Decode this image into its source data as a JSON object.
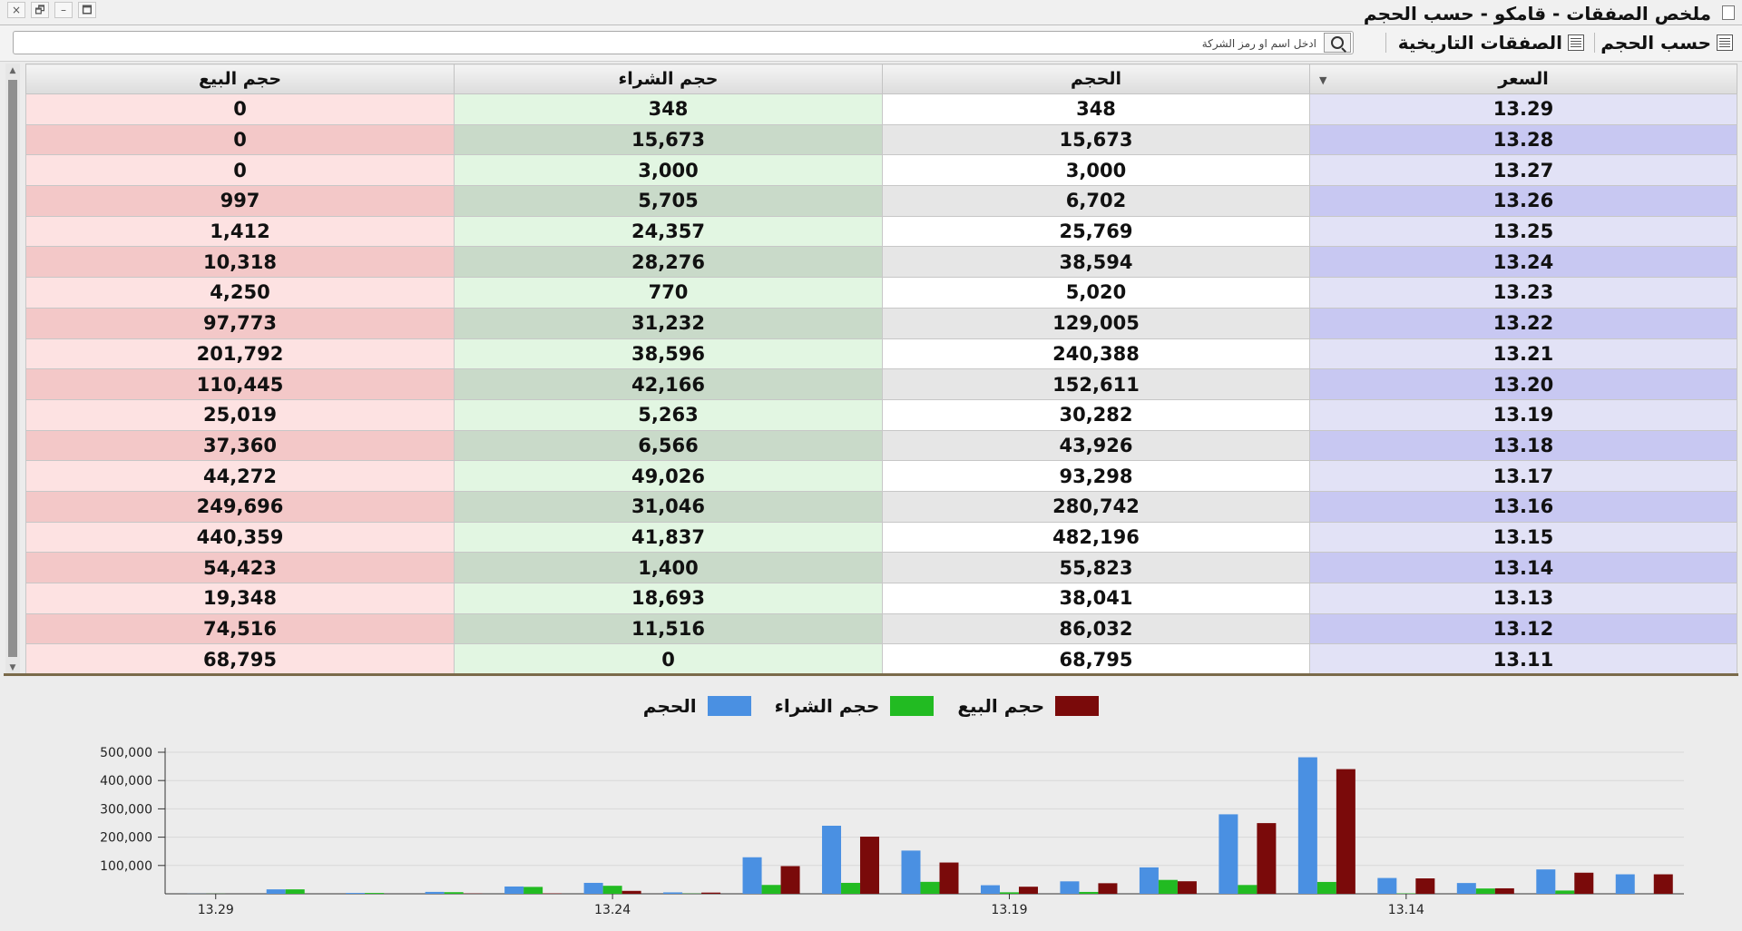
{
  "window": {
    "title": "ملخص الصفقات - قامكو - حسب الحجم",
    "controls": [
      "×",
      "🗗",
      "–",
      "🗖"
    ]
  },
  "toolbar": {
    "by_volume_label": "حسب الحجم",
    "historical_trades_label": "الصفقات التاريخية",
    "search_placeholder": "ادخل اسم او رمز الشركة"
  },
  "table": {
    "columns": [
      "السعر",
      "الحجم",
      "حجم الشراء",
      "حجم البيع"
    ],
    "rows": [
      [
        "13.29",
        "348",
        "348",
        "0"
      ],
      [
        "13.28",
        "15,673",
        "15,673",
        "0"
      ],
      [
        "13.27",
        "3,000",
        "3,000",
        "0"
      ],
      [
        "13.26",
        "6,702",
        "5,705",
        "997"
      ],
      [
        "13.25",
        "25,769",
        "24,357",
        "1,412"
      ],
      [
        "13.24",
        "38,594",
        "28,276",
        "10,318"
      ],
      [
        "13.23",
        "5,020",
        "770",
        "4,250"
      ],
      [
        "13.22",
        "129,005",
        "31,232",
        "97,773"
      ],
      [
        "13.21",
        "240,388",
        "38,596",
        "201,792"
      ],
      [
        "13.20",
        "152,611",
        "42,166",
        "110,445"
      ],
      [
        "13.19",
        "30,282",
        "5,263",
        "25,019"
      ],
      [
        "13.18",
        "43,926",
        "6,566",
        "37,360"
      ],
      [
        "13.17",
        "93,298",
        "49,026",
        "44,272"
      ],
      [
        "13.16",
        "280,742",
        "31,046",
        "249,696"
      ],
      [
        "13.15",
        "482,196",
        "41,837",
        "440,359"
      ],
      [
        "13.14",
        "55,823",
        "1,400",
        "54,423"
      ],
      [
        "13.13",
        "38,041",
        "18,693",
        "19,348"
      ],
      [
        "13.12",
        "86,032",
        "11,516",
        "74,516"
      ],
      [
        "13.11",
        "68,795",
        "0",
        "68,795"
      ]
    ]
  },
  "colors": {
    "volume": "#4a90e2",
    "buy": "#22bb22",
    "sell": "#7a0a0a"
  },
  "chart_data": {
    "type": "bar",
    "categories": [
      "13.29",
      "13.28",
      "13.27",
      "13.26",
      "13.25",
      "13.24",
      "13.23",
      "13.22",
      "13.21",
      "13.20",
      "13.19",
      "13.18",
      "13.17",
      "13.16",
      "13.15",
      "13.14",
      "13.13",
      "13.12",
      "13.11"
    ],
    "tick_labels": [
      "13.29",
      "13.24",
      "13.19",
      "13.14"
    ],
    "y_ticks": [
      "100,000",
      "200,000",
      "300,000",
      "400,000",
      "500,000"
    ],
    "ylim": [
      0,
      500000
    ],
    "grid": true,
    "legend_position": "top-center",
    "series": [
      {
        "name": "الحجم",
        "values": [
          348,
          15673,
          3000,
          6702,
          25769,
          38594,
          5020,
          129005,
          240388,
          152611,
          30282,
          43926,
          93298,
          280742,
          482196,
          55823,
          38041,
          86032,
          68795
        ]
      },
      {
        "name": "حجم الشراء",
        "values": [
          348,
          15673,
          3000,
          5705,
          24357,
          28276,
          770,
          31232,
          38596,
          42166,
          5263,
          6566,
          49026,
          31046,
          41837,
          1400,
          18693,
          11516,
          0
        ]
      },
      {
        "name": "حجم البيع",
        "values": [
          0,
          0,
          0,
          997,
          1412,
          10318,
          4250,
          97773,
          201792,
          110445,
          25019,
          37360,
          44272,
          249696,
          440359,
          54423,
          19348,
          74516,
          68795
        ]
      }
    ]
  }
}
